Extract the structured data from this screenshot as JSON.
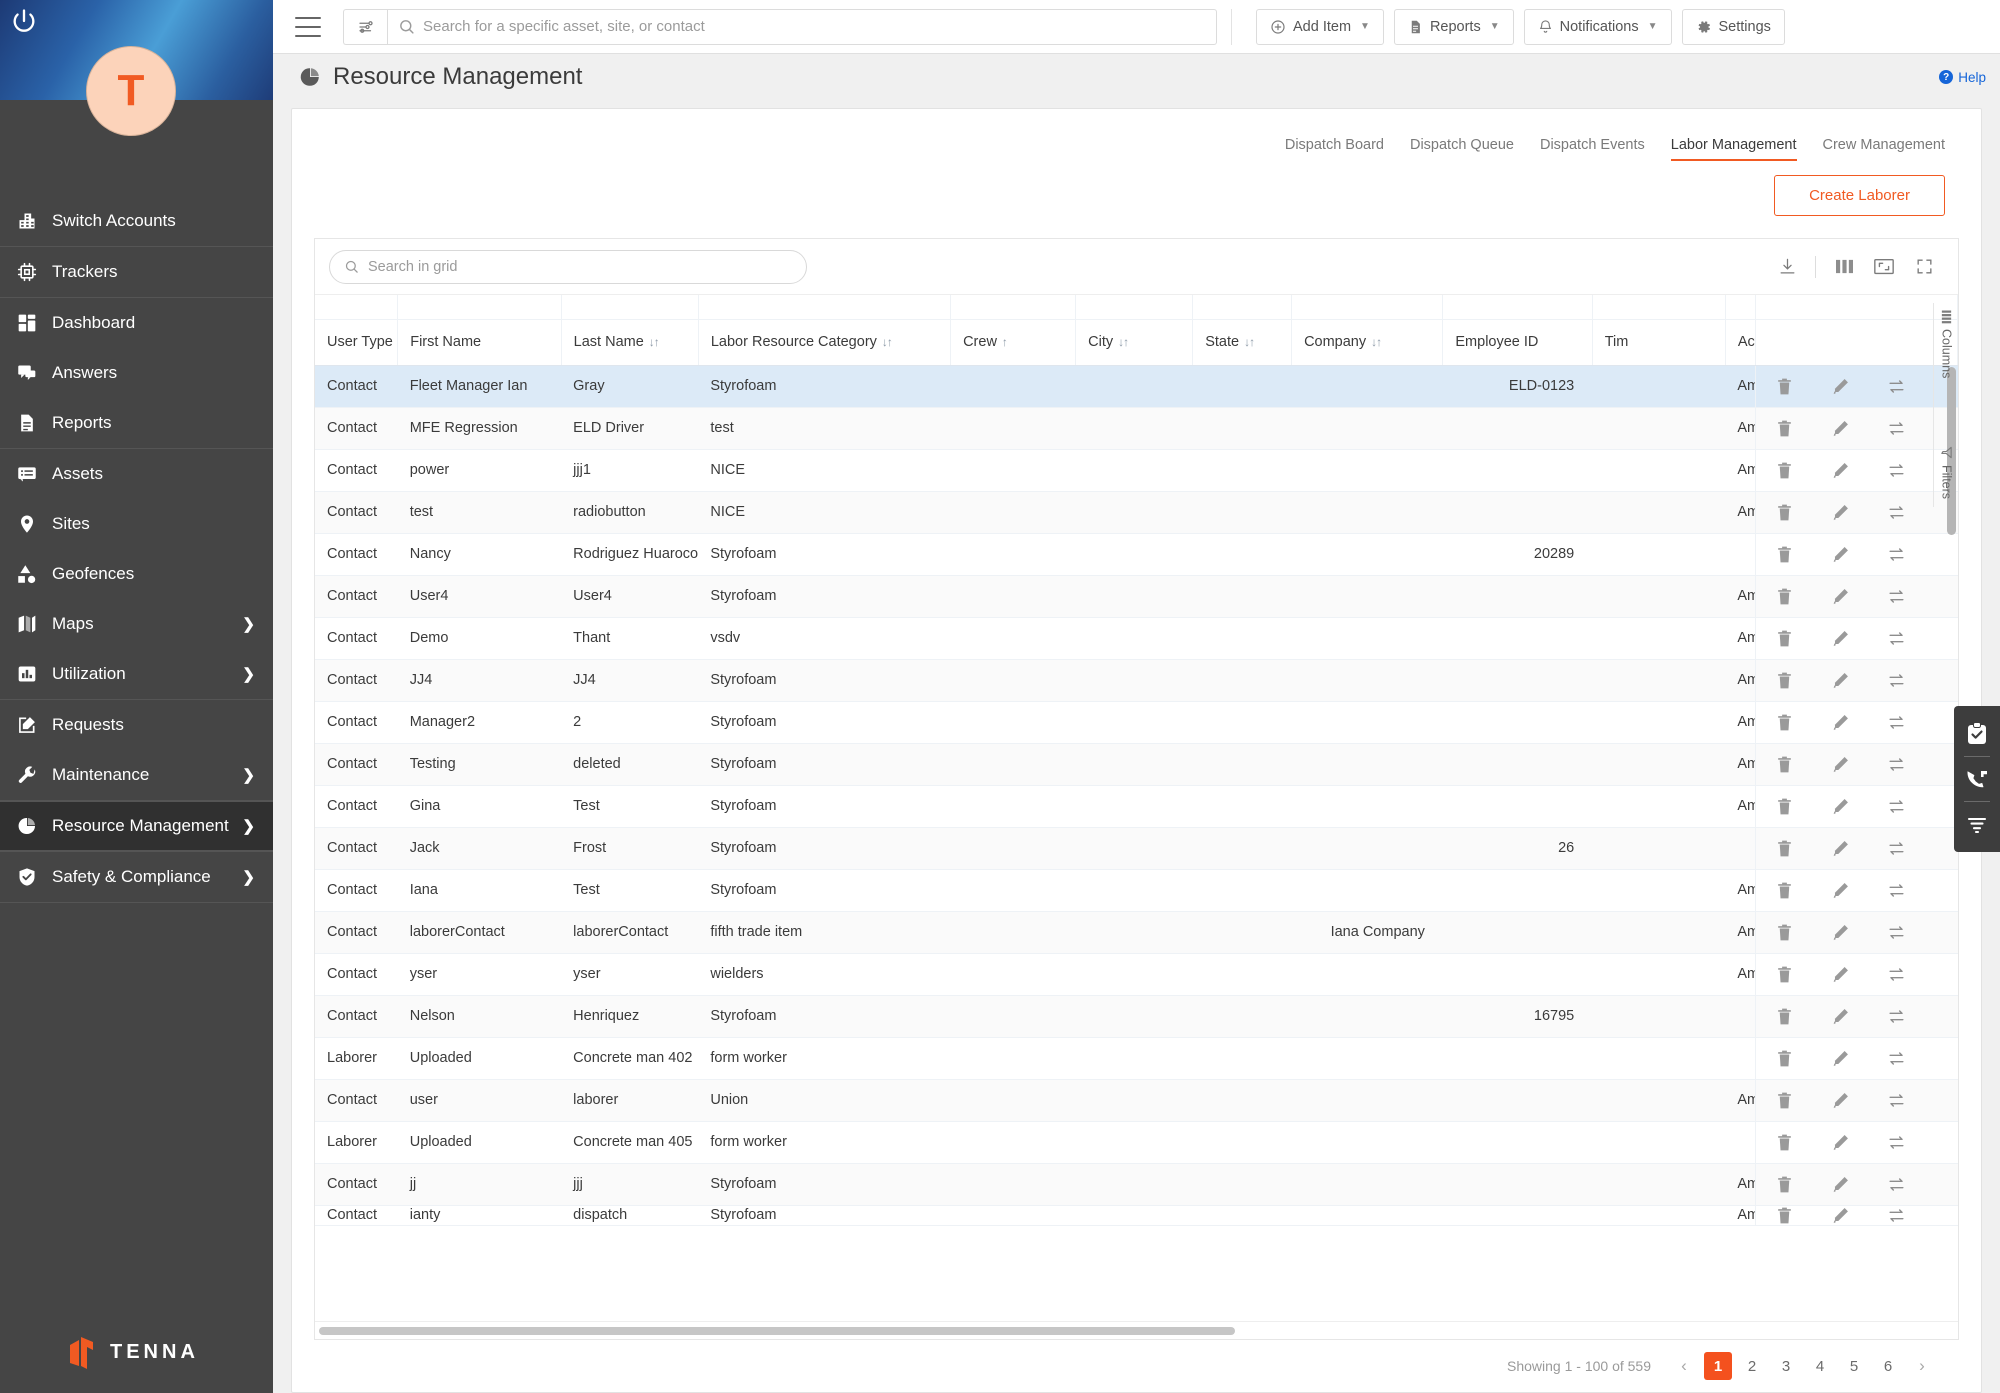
{
  "brand": {
    "logo_text": "TENNA",
    "accent": "#f15a22"
  },
  "sidebar": {
    "avatar_letter": "T",
    "groups": [
      {
        "items": [
          {
            "label": "Switch Accounts",
            "icon": "building-icon",
            "has_chevron": false
          }
        ]
      },
      {
        "items": [
          {
            "label": "Trackers",
            "icon": "chip-icon",
            "has_chevron": false
          }
        ]
      },
      {
        "items": [
          {
            "label": "Dashboard",
            "icon": "dashboard-icon",
            "has_chevron": false
          },
          {
            "label": "Answers",
            "icon": "chat-icon",
            "has_chevron": false
          },
          {
            "label": "Reports",
            "icon": "document-icon",
            "has_chevron": false
          }
        ]
      },
      {
        "items": [
          {
            "label": "Assets",
            "icon": "list-box-icon",
            "has_chevron": false
          },
          {
            "label": "Sites",
            "icon": "map-pin-icon",
            "has_chevron": false
          },
          {
            "label": "Geofences",
            "icon": "shapes-icon",
            "has_chevron": false
          },
          {
            "label": "Maps",
            "icon": "map-icon",
            "has_chevron": true
          },
          {
            "label": "Utilization",
            "icon": "bar-chart-icon",
            "has_chevron": true
          }
        ]
      },
      {
        "items": [
          {
            "label": "Requests",
            "icon": "edit-square-icon",
            "has_chevron": false
          },
          {
            "label": "Maintenance",
            "icon": "wrench-icon",
            "has_chevron": true
          }
        ]
      },
      {
        "items": [
          {
            "label": "Resource Management",
            "icon": "pie-chart-icon",
            "has_chevron": true,
            "active": true
          }
        ]
      },
      {
        "items": [
          {
            "label": "Safety & Compliance",
            "icon": "shield-check-icon",
            "has_chevron": true
          }
        ]
      }
    ]
  },
  "topbar": {
    "search_placeholder": "Search for a specific asset, site, or contact",
    "search_value": "",
    "buttons": [
      {
        "label": "Add Item",
        "icon": "plus-circle-icon"
      },
      {
        "label": "Reports",
        "icon": "document-icon"
      },
      {
        "label": "Notifications",
        "icon": "bell-icon"
      },
      {
        "label": "Settings",
        "icon": "gear-icon"
      }
    ]
  },
  "page": {
    "title": "Resource Management",
    "help_label": "Help",
    "tabs": [
      {
        "label": "Dispatch Board",
        "active": false
      },
      {
        "label": "Dispatch Queue",
        "active": false
      },
      {
        "label": "Dispatch Events",
        "active": false
      },
      {
        "label": "Labor Management",
        "active": true
      },
      {
        "label": "Crew Management",
        "active": false
      }
    ],
    "create_button": "Create Laborer"
  },
  "grid": {
    "search_placeholder": "Search in grid",
    "search_value": "",
    "tools": [
      {
        "name": "download-icon"
      },
      {
        "name": "columns-icon"
      },
      {
        "name": "fit-screen-icon"
      },
      {
        "name": "fullscreen-icon"
      }
    ],
    "side_tabs": [
      {
        "label": "Columns",
        "icon": "columns-icon"
      },
      {
        "label": "Filters",
        "icon": "funnel-icon"
      }
    ],
    "columns": [
      {
        "label": "User Type",
        "sortable": true,
        "sort": "both"
      },
      {
        "label": "First Name",
        "sortable": false,
        "sort": "none"
      },
      {
        "label": "Last Name",
        "sortable": true,
        "sort": "both"
      },
      {
        "label": "Labor Resource Category",
        "sortable": true,
        "sort": "both"
      },
      {
        "label": "Crew",
        "sortable": true,
        "sort": "asc"
      },
      {
        "label": "City",
        "sortable": true,
        "sort": "both"
      },
      {
        "label": "State",
        "sortable": true,
        "sort": "both"
      },
      {
        "label": "Company",
        "sortable": true,
        "sort": "both"
      },
      {
        "label": "Employee ID",
        "sortable": false,
        "sort": "none"
      },
      {
        "label": "Tim",
        "sortable": false,
        "sort": "none"
      },
      {
        "label": "Actions",
        "sortable": true,
        "sort": "both"
      }
    ],
    "row_actions": [
      {
        "name": "delete-icon"
      },
      {
        "name": "edit-icon"
      },
      {
        "name": "transfer-icon"
      }
    ],
    "rows": [
      {
        "user_type": "Contact",
        "first_name": "Fleet Manager Ian",
        "last_name": "Gray",
        "category": "Styrofoam",
        "crew": "",
        "city": "",
        "state": "",
        "company": "",
        "employee_id": "ELD-0123",
        "time": "Am",
        "selected": true
      },
      {
        "user_type": "Contact",
        "first_name": "MFE Regression",
        "last_name": "ELD Driver",
        "category": "test",
        "crew": "",
        "city": "",
        "state": "",
        "company": "",
        "employee_id": "",
        "time": "Am"
      },
      {
        "user_type": "Contact",
        "first_name": "power",
        "last_name": "jjj1",
        "category": "NICE",
        "crew": "",
        "city": "",
        "state": "",
        "company": "",
        "employee_id": "",
        "time": "Am"
      },
      {
        "user_type": "Contact",
        "first_name": "test",
        "last_name": "radiobutton",
        "category": "NICE",
        "crew": "",
        "city": "",
        "state": "",
        "company": "",
        "employee_id": "",
        "time": "Am"
      },
      {
        "user_type": "Contact",
        "first_name": "Nancy",
        "last_name": "Rodriguez Huaroco",
        "category": "Styrofoam",
        "crew": "",
        "city": "",
        "state": "",
        "company": "",
        "employee_id": "20289",
        "time": ""
      },
      {
        "user_type": "Contact",
        "first_name": "User4",
        "last_name": "User4",
        "category": "Styrofoam",
        "crew": "",
        "city": "",
        "state": "",
        "company": "",
        "employee_id": "",
        "time": "Am"
      },
      {
        "user_type": "Contact",
        "first_name": "Demo",
        "last_name": "Thant",
        "category": "vsdv",
        "crew": "",
        "city": "",
        "state": "",
        "company": "",
        "employee_id": "",
        "time": "Am"
      },
      {
        "user_type": "Contact",
        "first_name": "JJ4",
        "last_name": "JJ4",
        "category": "Styrofoam",
        "crew": "",
        "city": "",
        "state": "",
        "company": "",
        "employee_id": "",
        "time": "Am"
      },
      {
        "user_type": "Contact",
        "first_name": "Manager2",
        "last_name": "2",
        "category": "Styrofoam",
        "crew": "",
        "city": "",
        "state": "",
        "company": "",
        "employee_id": "",
        "time": "Am"
      },
      {
        "user_type": "Contact",
        "first_name": "Testing",
        "last_name": "deleted",
        "category": "Styrofoam",
        "crew": "",
        "city": "",
        "state": "",
        "company": "",
        "employee_id": "",
        "time": "Am"
      },
      {
        "user_type": "Contact",
        "first_name": "Gina",
        "last_name": "Test",
        "category": "Styrofoam",
        "crew": "",
        "city": "",
        "state": "",
        "company": "",
        "employee_id": "",
        "time": "Am"
      },
      {
        "user_type": "Contact",
        "first_name": "Jack",
        "last_name": "Frost",
        "category": "Styrofoam",
        "crew": "",
        "city": "",
        "state": "",
        "company": "",
        "employee_id": "26",
        "time": ""
      },
      {
        "user_type": "Contact",
        "first_name": "Iana",
        "last_name": "Test",
        "category": "Styrofoam",
        "crew": "",
        "city": "",
        "state": "",
        "company": "",
        "employee_id": "",
        "time": "Am"
      },
      {
        "user_type": "Contact",
        "first_name": "laborerContact",
        "last_name": "laborerContact",
        "category": "fifth trade item",
        "crew": "",
        "city": "",
        "state": "",
        "company": "Iana Company",
        "employee_id": "",
        "time": "Am"
      },
      {
        "user_type": "Contact",
        "first_name": "yser",
        "last_name": "yser",
        "category": "wielders",
        "crew": "",
        "city": "",
        "state": "",
        "company": "",
        "employee_id": "",
        "time": "Am"
      },
      {
        "user_type": "Contact",
        "first_name": "Nelson",
        "last_name": "Henriquez",
        "category": "Styrofoam",
        "crew": "",
        "city": "",
        "state": "",
        "company": "",
        "employee_id": "16795",
        "time": ""
      },
      {
        "user_type": "Laborer",
        "first_name": "Uploaded",
        "last_name": "Concrete man 402",
        "category": "form worker",
        "crew": "",
        "city": "",
        "state": "",
        "company": "",
        "employee_id": "",
        "time": ""
      },
      {
        "user_type": "Contact",
        "first_name": "user",
        "last_name": "laborer",
        "category": "Union",
        "crew": "",
        "city": "",
        "state": "",
        "company": "",
        "employee_id": "",
        "time": "Am"
      },
      {
        "user_type": "Laborer",
        "first_name": "Uploaded",
        "last_name": "Concrete man 405",
        "category": "form worker",
        "crew": "",
        "city": "",
        "state": "",
        "company": "",
        "employee_id": "",
        "time": ""
      },
      {
        "user_type": "Contact",
        "first_name": "jj",
        "last_name": "jjj",
        "category": "Styrofoam",
        "crew": "",
        "city": "",
        "state": "",
        "company": "",
        "employee_id": "",
        "time": "Am"
      },
      {
        "user_type": "Contact",
        "first_name": "ianty",
        "last_name": "dispatch",
        "category": "Styrofoam",
        "crew": "",
        "city": "",
        "state": "",
        "company": "",
        "employee_id": "",
        "time": "Am"
      }
    ]
  },
  "pagination": {
    "showing": "Showing 1 - 100 of 559",
    "prev": "‹",
    "next": "›",
    "pages": [
      "1",
      "2",
      "3",
      "4",
      "5",
      "6"
    ],
    "current": "1"
  },
  "fab": [
    {
      "name": "clipboard-check-icon"
    },
    {
      "name": "phone-support-icon"
    },
    {
      "name": "filter-lines-icon"
    }
  ]
}
